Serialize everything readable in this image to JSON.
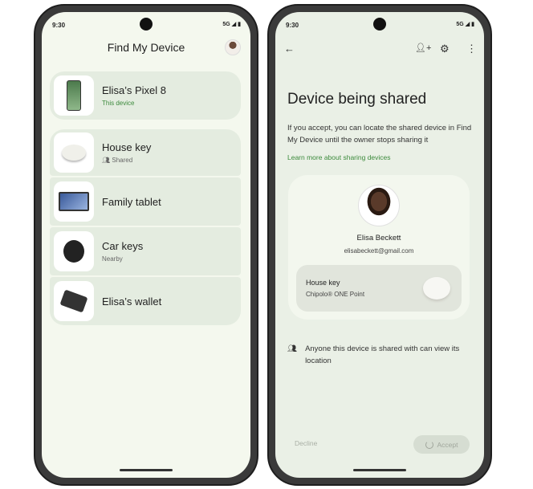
{
  "status_bar": {
    "time": "9:30",
    "network": "5G"
  },
  "list_screen": {
    "title": "Find My Device",
    "devices": [
      {
        "name": "Elisa’s Pixel 8",
        "subtitle": "This device",
        "icon": "phone"
      },
      {
        "name": "House key",
        "subtitle": "Shared",
        "icon": "tag-disc"
      },
      {
        "name": "Family tablet",
        "icon": "tablet"
      },
      {
        "name": "Car keys",
        "subtitle": "Nearby",
        "icon": "tag-black"
      },
      {
        "name": "Elisa’s wallet",
        "icon": "wallet-card"
      }
    ]
  },
  "share_screen": {
    "title": "Device being shared",
    "body": "If you accept, you can locate the shared device in Find My Device until the owner stops sharing it",
    "learn_more": "Learn more about sharing devices",
    "owner": {
      "name": "Elisa Beckett",
      "email": "elisabeckett@gmail.com"
    },
    "device": {
      "name": "House key",
      "model": "Chipolo® ONE Point"
    },
    "info": "Anyone this device is shared with can view its location",
    "decline_label": "Decline",
    "accept_label": "Accept"
  },
  "colors": {
    "accent": "#3c8a3c",
    "list_bg": "#f4f8ee",
    "card_bg": "#e4ece0"
  }
}
